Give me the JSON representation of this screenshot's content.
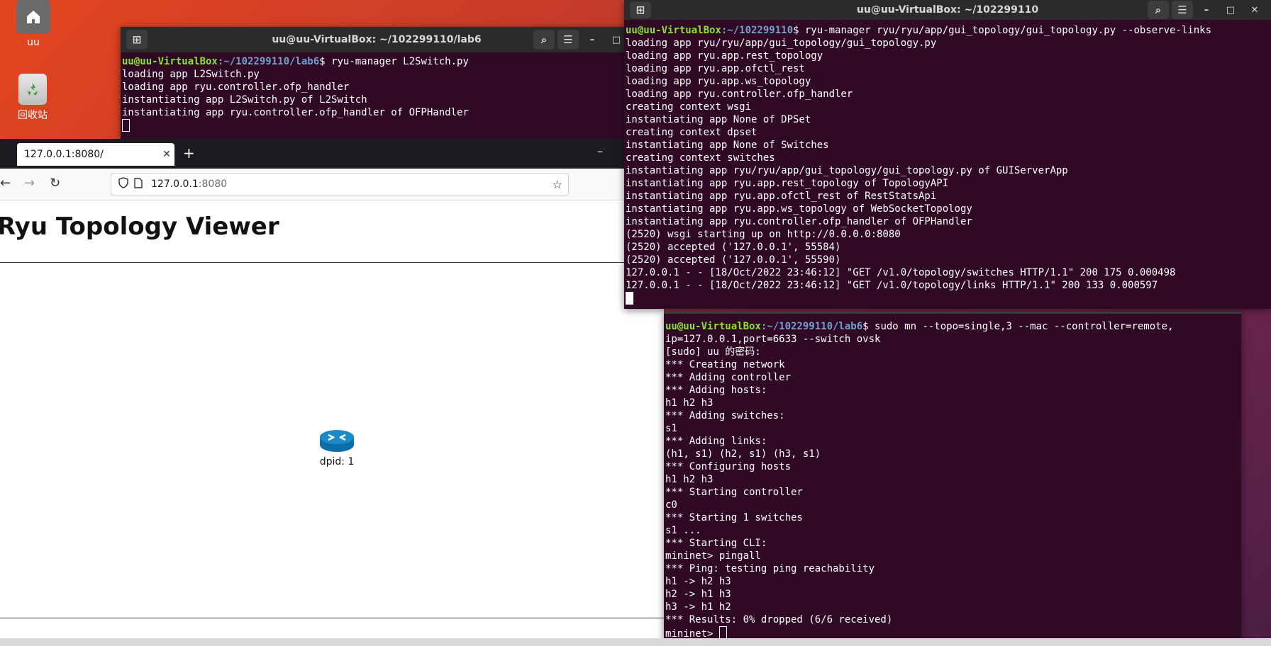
{
  "desktop": {
    "home_label": "uu",
    "trash_label": "回收站"
  },
  "term_lab6": {
    "title": "uu@uu-VirtualBox: ~/102299110/lab6",
    "prompt_user": "uu@uu-VirtualBox",
    "prompt_path": ":~/102299110/lab6",
    "command": "$ ryu-manager L2Switch.py",
    "lines": [
      "loading app L2Switch.py",
      "loading app ryu.controller.ofp_handler",
      "instantiating app L2Switch.py of L2Switch",
      "instantiating app ryu.controller.ofp_handler of OFPHandler"
    ]
  },
  "term_gui": {
    "title": "uu@uu-VirtualBox: ~/102299110",
    "prompt_user": "uu@uu-VirtualBox",
    "prompt_path": ":~/102299110",
    "command": "$ ryu-manager ryu/ryu/app/gui_topology/gui_topology.py --observe-links",
    "lines": [
      "loading app ryu/ryu/app/gui_topology/gui_topology.py",
      "loading app ryu.app.rest_topology",
      "loading app ryu.app.ofctl_rest",
      "loading app ryu.app.ws_topology",
      "loading app ryu.controller.ofp_handler",
      "creating context wsgi",
      "instantiating app None of DPSet",
      "creating context dpset",
      "instantiating app None of Switches",
      "creating context switches",
      "instantiating app ryu/ryu/app/gui_topology/gui_topology.py of GUIServerApp",
      "instantiating app ryu.app.rest_topology of TopologyAPI",
      "instantiating app ryu.app.ofctl_rest of RestStatsApi",
      "instantiating app ryu.app.ws_topology of WebSocketTopology",
      "instantiating app ryu.controller.ofp_handler of OFPHandler",
      "(2520) wsgi starting up on http://0.0.0.0:8080",
      "(2520) accepted ('127.0.0.1', 55584)",
      "(2520) accepted ('127.0.0.1', 55590)",
      "127.0.0.1 - - [18/Oct/2022 23:46:12] \"GET /v1.0/topology/switches HTTP/1.1\" 200 175 0.000498",
      "127.0.0.1 - - [18/Oct/2022 23:46:12] \"GET /v1.0/topology/links HTTP/1.1\" 200 133 0.000597"
    ]
  },
  "term_mininet": {
    "prompt_user": "uu@uu-VirtualBox",
    "prompt_path": ":~/102299110/lab6",
    "command": "$ sudo mn --topo=single,3 --mac --controller=remote,",
    "lines": [
      "ip=127.0.0.1,port=6633 --switch ovsk",
      "[sudo] uu 的密码:",
      "*** Creating network",
      "*** Adding controller",
      "*** Adding hosts:",
      "h1 h2 h3",
      "*** Adding switches:",
      "s1",
      "*** Adding links:",
      "(h1, s1) (h2, s1) (h3, s1)",
      "*** Configuring hosts",
      "h1 h2 h3",
      "*** Starting controller",
      "c0",
      "*** Starting 1 switches",
      "s1 ...",
      "*** Starting CLI:",
      "mininet> pingall",
      "*** Ping: testing ping reachability",
      "h1 -> h2 h3",
      "h2 -> h1 h3",
      "h3 -> h1 h2",
      "*** Results: 0% dropped (6/6 received)"
    ],
    "final_prompt": "mininet> "
  },
  "browser": {
    "tab_title": "127.0.0.1:8080/",
    "url_host": "127.0.0.1",
    "url_port": ":8080",
    "page_title": "Ryu Topology Viewer",
    "node_label": "dpid: 1"
  },
  "colors": {
    "terminal_bg": "#300a24",
    "prompt_user": "#8ae234",
    "prompt_path": "#729fcf"
  }
}
